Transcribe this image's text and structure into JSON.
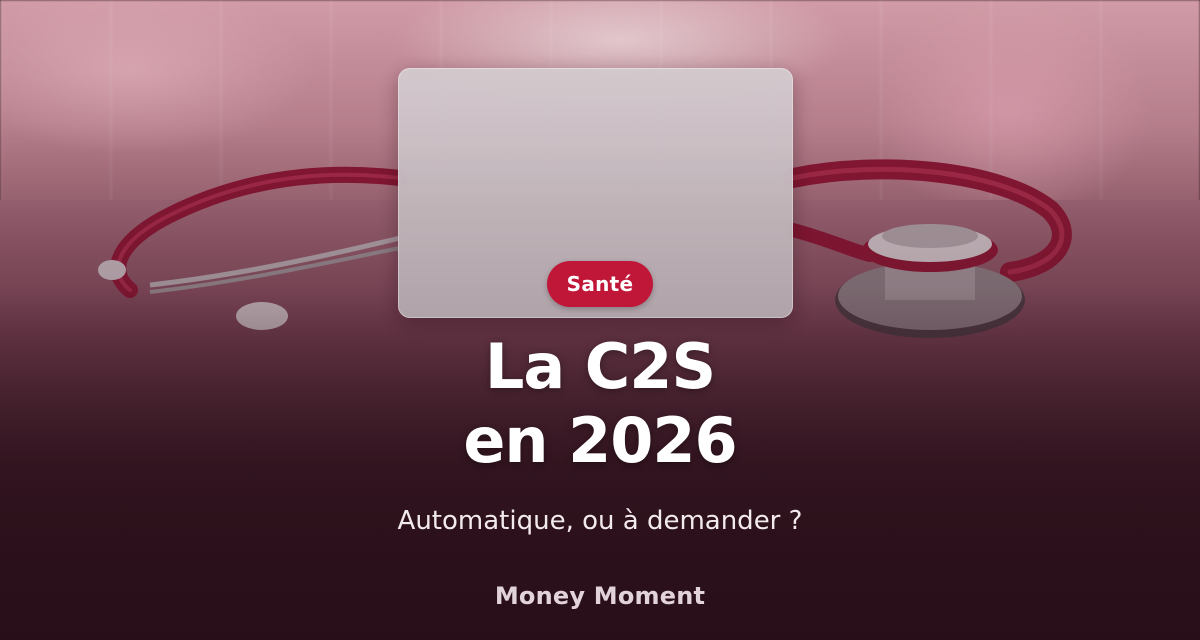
{
  "hero": {
    "category_badge": "Santé",
    "title_line1": "La C2S",
    "title_line2": "en 2026",
    "subtitle": "Automatique, ou à demander ?",
    "brand": "Money Moment"
  },
  "colors": {
    "badge_background": "#c01638",
    "title_text": "#ffffff",
    "background_dark": "#2c141d",
    "stethoscope_tube": "#a4163a"
  },
  "icons": {
    "background_image": "stethoscope-photo",
    "card": "blank-glass-card"
  }
}
